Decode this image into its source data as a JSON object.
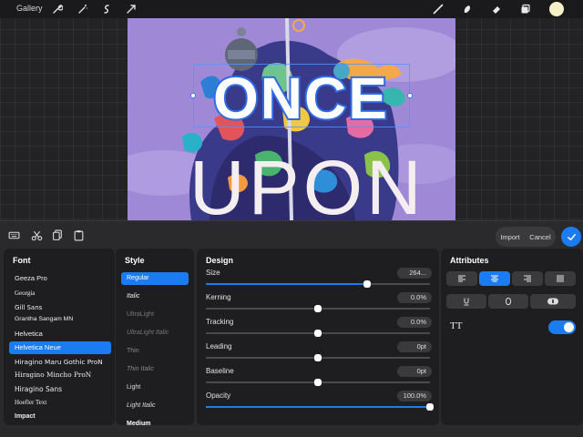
{
  "toolbar": {
    "gallery_label": "Gallery",
    "icons": [
      "wrench-icon",
      "magic-wand-icon",
      "selection-icon",
      "transform-arrow-icon",
      "brush-icon",
      "smudge-icon",
      "eraser-icon",
      "layers-icon",
      "color-swatch"
    ],
    "color_swatch": "#f4f0c8"
  },
  "artwork": {
    "line1": "ONCE",
    "line2": "UPON"
  },
  "panel": {
    "tools": [
      "keyboard-icon",
      "scissors-icon",
      "copy-icon",
      "paste-icon"
    ],
    "import_label": "Import",
    "cancel_label": "Cancel",
    "accent": "#1b7cf2"
  },
  "font_column": {
    "title": "Font",
    "fonts": [
      "Geeza Pro",
      "Georgia",
      "Gill Sans",
      "Grantha Sangam MN",
      "Helvetica",
      "Helvetica Neue",
      "Hiragino Maru Gothic ProN",
      "Hiragino Mincho ProN",
      "Hiragino Sans",
      "Hoefler Text",
      "Impact"
    ],
    "selected": "Helvetica Neue"
  },
  "style_column": {
    "title": "Style",
    "styles": [
      "Regular",
      "Italic",
      "UltraLight",
      "UltraLight Italic",
      "Thin",
      "Thin Italic",
      "Light",
      "Light Italic",
      "Medium"
    ],
    "selected": "Regular"
  },
  "design_column": {
    "title": "Design",
    "rows": [
      {
        "label": "Size",
        "value": "264...",
        "level": 0.72
      },
      {
        "label": "Kerning",
        "value": "0.0%",
        "level": 0.5
      },
      {
        "label": "Tracking",
        "value": "0.0%",
        "level": 0.5
      },
      {
        "label": "Leading",
        "value": "0pt",
        "level": 0.5
      },
      {
        "label": "Baseline",
        "value": "0pt",
        "level": 0.5
      },
      {
        "label": "Opacity",
        "value": "100.0%",
        "level": 1.0
      }
    ]
  },
  "attributes_column": {
    "title": "Attributes",
    "alignments": [
      "align-left-icon",
      "align-center-icon",
      "align-right-icon",
      "justify-icon"
    ],
    "selected_alignment": "align-center-icon",
    "decorations": [
      "underline-icon",
      "outline-icon",
      "capsule-icon"
    ],
    "allcaps_label": "TT",
    "allcaps_on": true
  }
}
